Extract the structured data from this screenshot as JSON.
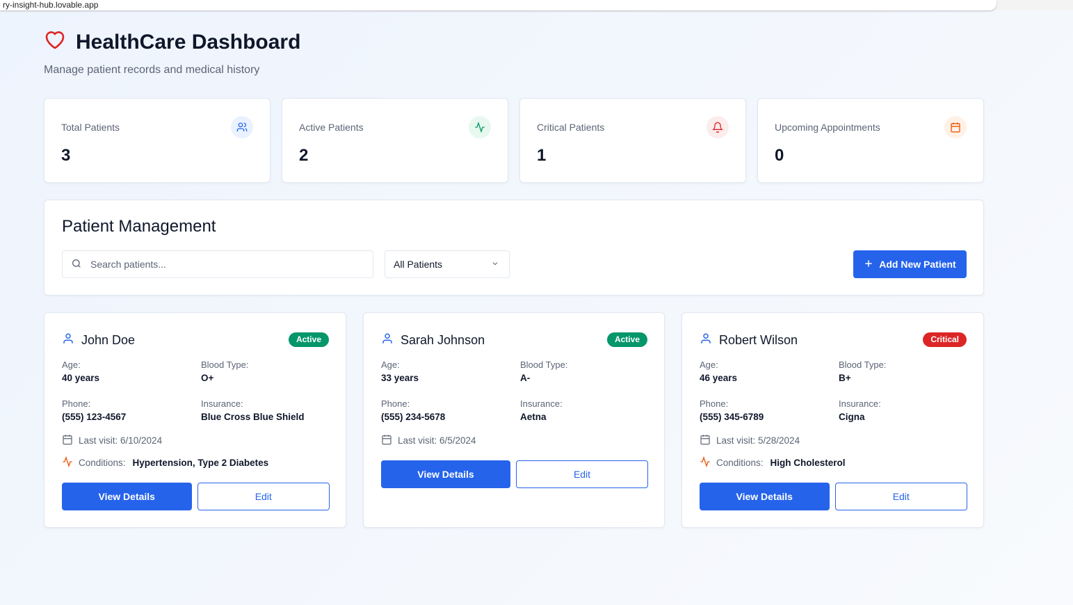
{
  "browser": {
    "url": "ry-insight-hub.lovable.app"
  },
  "header": {
    "title": "HealthCare Dashboard",
    "subtitle": "Manage patient records and medical history"
  },
  "stats": [
    {
      "label": "Total Patients",
      "value": "3",
      "icon": "users-icon",
      "color": "#2563eb",
      "bg": "#eaf2ff"
    },
    {
      "label": "Active Patients",
      "value": "2",
      "icon": "activity-icon",
      "color": "#059669",
      "bg": "#e7f8ef"
    },
    {
      "label": "Critical Patients",
      "value": "1",
      "icon": "bell-icon",
      "color": "#dc2626",
      "bg": "#fdecec"
    },
    {
      "label": "Upcoming Appointments",
      "value": "0",
      "icon": "calendar-icon",
      "color": "#ea580c",
      "bg": "#fff1e6"
    }
  ],
  "management": {
    "title": "Patient Management",
    "search_placeholder": "Search patients...",
    "filter": "All Patients",
    "add_label": "Add New Patient"
  },
  "labels": {
    "age": "Age:",
    "blood": "Blood Type:",
    "phone": "Phone:",
    "insurance": "Insurance:",
    "conditions": "Conditions:",
    "view": "View Details",
    "edit": "Edit"
  },
  "patients": [
    {
      "name": "John Doe",
      "status": "Active",
      "status_color": "#059669",
      "age": "40 years",
      "blood": "O+",
      "phone": "(555) 123-4567",
      "insurance": "Blue Cross Blue Shield",
      "last_visit": "Last visit: 6/10/2024",
      "conditions": "Hypertension, Type 2 Diabetes"
    },
    {
      "name": "Sarah Johnson",
      "status": "Active",
      "status_color": "#059669",
      "age": "33 years",
      "blood": "A-",
      "phone": "(555) 234-5678",
      "insurance": "Aetna",
      "last_visit": "Last visit: 6/5/2024",
      "conditions": null
    },
    {
      "name": "Robert Wilson",
      "status": "Critical",
      "status_color": "#dc2626",
      "age": "46 years",
      "blood": "B+",
      "phone": "(555) 345-6789",
      "insurance": "Cigna",
      "last_visit": "Last visit: 5/28/2024",
      "conditions": "High Cholesterol"
    }
  ]
}
